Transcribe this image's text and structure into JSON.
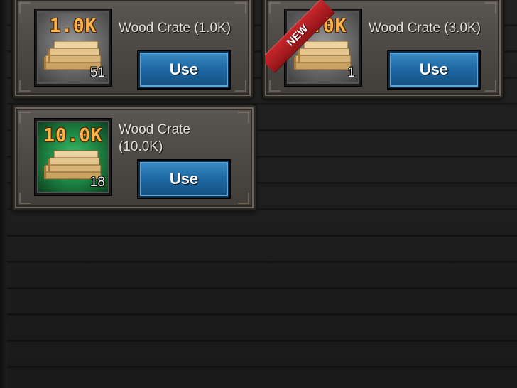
{
  "items": [
    {
      "name": "Wood Crate (1.0K)",
      "amount": "1.0K",
      "quantity": "51",
      "use_label": "Use",
      "badge": "",
      "icon": "wood-planks-icon",
      "background": "gray"
    },
    {
      "name": "Wood Crate (3.0K)",
      "amount": "3.0K",
      "quantity": "1",
      "use_label": "Use",
      "badge": "NEW",
      "icon": "wood-planks-icon",
      "background": "gray"
    },
    {
      "name_line1": "Wood Crate",
      "name_line2": "(10.0K)",
      "amount": "10.0K",
      "quantity": "18",
      "use_label": "Use",
      "badge": "",
      "icon": "wood-planks-icon",
      "background": "green"
    }
  ],
  "colors": {
    "amount_text": "#ffb347",
    "use_button": "#1f6aa6",
    "new_ribbon": "#c8262b",
    "rare_frame": "#1f8a45"
  }
}
